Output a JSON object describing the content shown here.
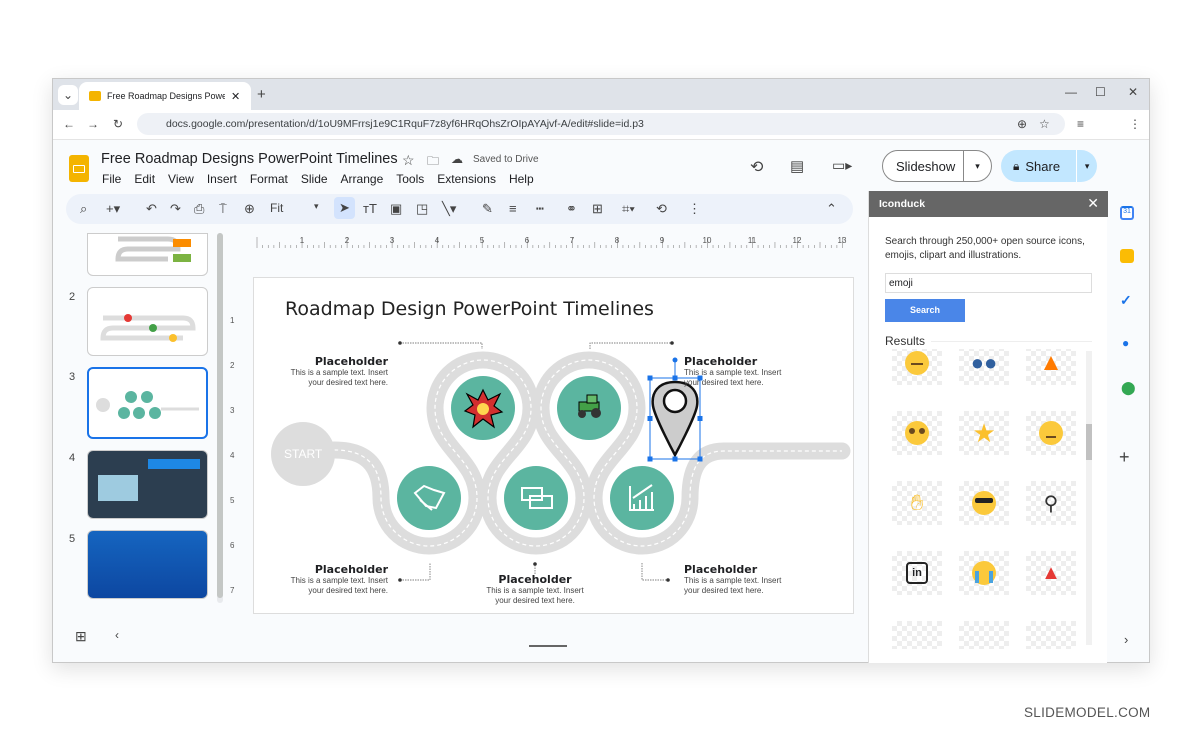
{
  "browser": {
    "tab_title": "Free Roadmap Designs PowerPoint Timelines",
    "url": "docs.google.com/presentation/d/1oU9MFrrsj1e9C1RquF7z8yf6HRqOhsZrOIpAYAjvf-A/edit#slide=id.p3"
  },
  "app": {
    "doc_title": "Free Roadmap Designs PowerPoint Timelines",
    "save_status": "Saved to Drive",
    "menu": [
      "File",
      "Edit",
      "View",
      "Insert",
      "Format",
      "Slide",
      "Arrange",
      "Tools",
      "Extensions",
      "Help"
    ],
    "zoom": "Fit",
    "slideshow_label": "Slideshow",
    "share_label": "Share",
    "accent": "#c2e7ff"
  },
  "filmstrip": {
    "slides": [
      "2",
      "3",
      "4",
      "5"
    ],
    "selected": "3"
  },
  "ruler": {
    "h": [
      "1",
      "2",
      "3",
      "4",
      "5",
      "6",
      "7",
      "8",
      "9",
      "10",
      "11",
      "12",
      "13"
    ],
    "v": [
      "1",
      "2",
      "3",
      "4",
      "5",
      "6",
      "7"
    ]
  },
  "slide": {
    "title": "Roadmap Design PowerPoint Timelines",
    "start": "START",
    "teal": "#5bb5a0",
    "items": [
      {
        "heading": "Placeholder",
        "text1": "This is a sample text. Insert",
        "text2": "your desired text here.",
        "icon": "explosion-icon"
      },
      {
        "heading": "Placeholder",
        "text1": "This is a sample text. Insert",
        "text2": "your desired text here.",
        "icon": "tractor-icon"
      },
      {
        "heading": "Placeholder",
        "text1": "This is a sample text. Insert",
        "text2": "your desired text here.",
        "icon": "handshake-icon"
      },
      {
        "heading": "Placeholder",
        "text1": "This is a sample text. Insert",
        "text2": "your desired text here.",
        "icon": "money-card-icon"
      },
      {
        "heading": "Placeholder",
        "text1": "This is a sample text. Insert",
        "text2": "your desired text here.",
        "icon": "growth-chart-icon"
      }
    ]
  },
  "panel": {
    "title": "Iconduck",
    "description1": "Search through 250,000+ open source icons,",
    "description2": "emojis, clipart and illustrations.",
    "search_value": "emoji",
    "search_button": "Search",
    "results_label": "Results",
    "results": [
      "confused-face",
      "people-hugging",
      "fire",
      "pleading-face",
      "star",
      "neutral-face",
      "waving-hand",
      "sunglasses-face",
      "location-pin",
      "linkedin",
      "crying-face",
      "party-popper"
    ]
  },
  "watermark": "SLIDEMODEL.COM"
}
